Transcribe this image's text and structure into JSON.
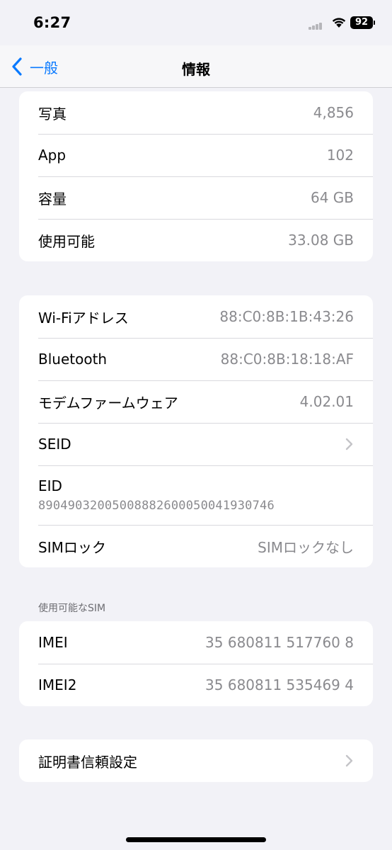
{
  "status_bar": {
    "time": "6:27",
    "battery": "92"
  },
  "nav": {
    "back_label": "一般",
    "title": "情報"
  },
  "storage_group": [
    {
      "label": "写真",
      "value": "4,856"
    },
    {
      "label": "App",
      "value": "102"
    },
    {
      "label": "容量",
      "value": "64 GB"
    },
    {
      "label": "使用可能",
      "value": "33.08 GB"
    }
  ],
  "network_group": {
    "wifi": {
      "label": "Wi-Fiアドレス",
      "value": "88:C0:8B:1B:43:26"
    },
    "bluetooth": {
      "label": "Bluetooth",
      "value": "88:C0:8B:18:18:AF"
    },
    "modem": {
      "label": "モデムファームウェア",
      "value": "4.02.01"
    },
    "seid": {
      "label": "SEID"
    },
    "eid": {
      "label": "EID",
      "value": "89049032005008882600050041930746"
    },
    "simlock": {
      "label": "SIMロック",
      "value": "SIMロックなし"
    }
  },
  "sim_section": {
    "header": "使用可能なSIM",
    "imei": {
      "label": "IMEI",
      "value": "35 680811 517760 8"
    },
    "imei2": {
      "label": "IMEI2",
      "value": "35 680811 535469 4"
    }
  },
  "cert": {
    "label": "証明書信頼設定"
  },
  "icons": {
    "back": "chevron-left-icon",
    "disclosure": "chevron-right-icon",
    "wifi": "wifi-icon",
    "signal": "cellular-signal-icon",
    "battery": "battery-icon"
  },
  "colors": {
    "accent": "#0a7aff",
    "background": "#f2f2f7",
    "secondary_text": "#8a8a8e"
  }
}
